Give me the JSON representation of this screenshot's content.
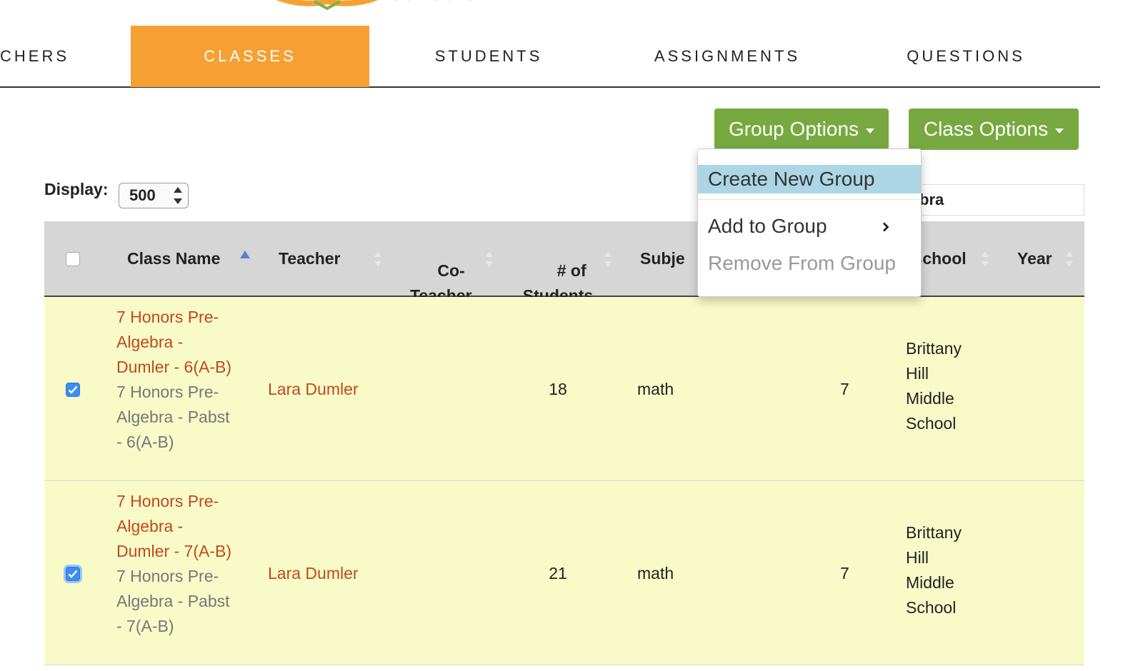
{
  "logo": {
    "text": "schools"
  },
  "nav": {
    "tabs": [
      {
        "label": "CHERS"
      },
      {
        "label": "CLASSES",
        "active": true
      },
      {
        "label": "STUDENTS"
      },
      {
        "label": "ASSIGNMENTS"
      },
      {
        "label": "QUESTIONS"
      }
    ]
  },
  "toolbar": {
    "group_options": "Group Options",
    "class_options": "Class Options"
  },
  "dropdown": {
    "items": [
      {
        "label": "Create New Group",
        "state": "highlighted"
      },
      {
        "label": "Add to Group",
        "submenu": true
      },
      {
        "label": "Remove From Group",
        "state": "disabled"
      }
    ]
  },
  "display": {
    "label": "Display:",
    "value": "500"
  },
  "search": {
    "value": "bra"
  },
  "table": {
    "columns": [
      "Class Name",
      "Teacher",
      "Co-\nTeacher",
      "# of\nStudents",
      "Subje",
      "School",
      "Year"
    ],
    "rows": [
      {
        "checked": true,
        "class_name": "7 Honors Pre-Algebra - Dumler - 6(A-B)",
        "class_name_lines": [
          "7 Honors Pre-",
          "Algebra -",
          "Dumler - 6(A-B)"
        ],
        "alt_name_lines": [
          "7 Honors Pre-",
          "Algebra - Pabst",
          "- 6(A-B)"
        ],
        "teacher": "Lara Dumler",
        "students": "18",
        "subject": "math",
        "grade": "7",
        "school_lines": [
          "Brittany",
          "Hill",
          "Middle",
          "School"
        ]
      },
      {
        "checked": true,
        "class_name": "7 Honors Pre-Algebra - Dumler - 7(A-B)",
        "class_name_lines": [
          "7 Honors Pre-",
          "Algebra -",
          "Dumler - 7(A-B)"
        ],
        "alt_name_lines": [
          "7 Honors Pre-",
          "Algebra - Pabst",
          "- 7(A-B)"
        ],
        "teacher": "Lara Dumler",
        "students": "21",
        "subject": "math",
        "grade": "7",
        "school_lines": [
          "Brittany",
          "Hill",
          "Middle",
          "School"
        ]
      }
    ]
  },
  "colors": {
    "accent_orange": "#f6a033",
    "button_green": "#77a940",
    "row_highlight": "#f8fbc8",
    "link": "#c4481b",
    "menu_highlight": "#acd6e5"
  }
}
